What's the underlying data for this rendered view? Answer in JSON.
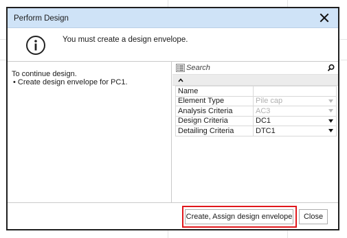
{
  "dialog": {
    "title": "Perform Design",
    "info_message": "You must create a design envelope.",
    "left_pane": {
      "line1": "To continue design.",
      "line2": "• Create design envelope for PC1."
    },
    "property_grid": {
      "search_placeholder": "Search",
      "rows": [
        {
          "name": "Name",
          "value": "",
          "disabled": false,
          "dropdown": false
        },
        {
          "name": "Element Type",
          "value": "Pile cap",
          "disabled": true,
          "dropdown": true
        },
        {
          "name": "Analysis Criteria",
          "value": "AC3",
          "disabled": true,
          "dropdown": true
        },
        {
          "name": "Design Criteria",
          "value": "DC1",
          "disabled": false,
          "dropdown": true
        },
        {
          "name": "Detailing Criteria",
          "value": "DTC1",
          "disabled": false,
          "dropdown": true
        }
      ]
    },
    "buttons": {
      "create_label": "Create, Assign design envelope",
      "close_label": "Close"
    },
    "icons": [
      "close-icon",
      "info-icon",
      "categorize-icon",
      "search-icon",
      "collapse-icon",
      "dropdown-arrow-icon"
    ],
    "colors": {
      "titlebar": "#cfe3f7",
      "highlight": "#e0161b",
      "disabled_text": "#b0b0b0"
    }
  }
}
